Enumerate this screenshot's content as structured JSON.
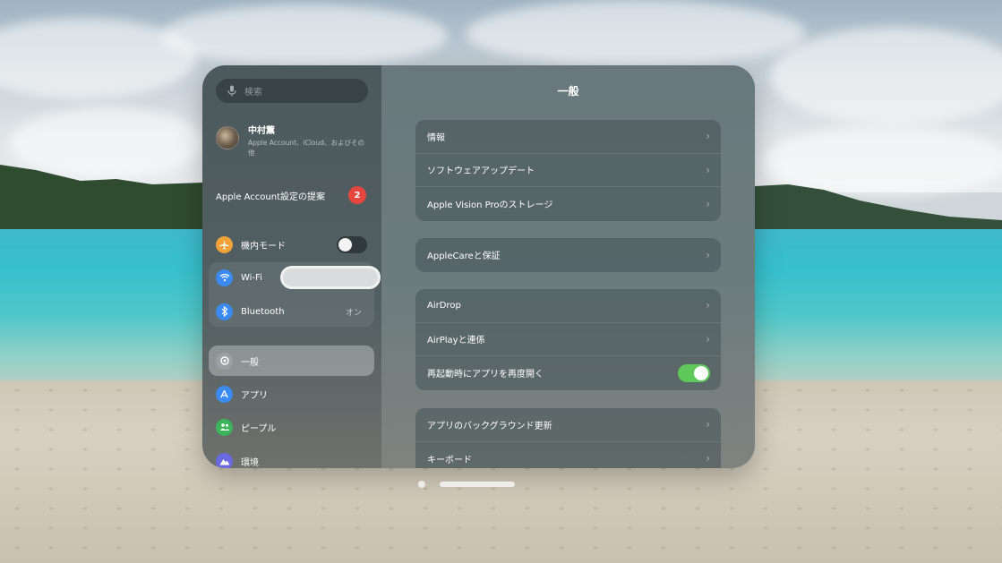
{
  "search": {
    "placeholder": "検索"
  },
  "profile": {
    "name": "中村薫",
    "subtitle": "Apple Account、iCloud、およびその他"
  },
  "suggestion": {
    "label": "Apple Account設定の提案",
    "badge": "2"
  },
  "sidebar": {
    "items": [
      {
        "label": "機内モード",
        "icon": "airplane-icon",
        "color": "#f0a23a",
        "toggle": false
      },
      {
        "label": "Wi-Fi",
        "icon": "wifi-icon",
        "color": "#3b8af0"
      },
      {
        "label": "Bluetooth",
        "icon": "bluetooth-icon",
        "color": "#3b8af0",
        "value": "オン"
      },
      {
        "label": "一般",
        "icon": "gear-icon",
        "color": "#9aa0a3"
      },
      {
        "label": "アプリ",
        "icon": "app-store-icon",
        "color": "#3b8af0"
      },
      {
        "label": "ピープル",
        "icon": "people-icon",
        "color": "#3cb55a"
      },
      {
        "label": "環境",
        "icon": "mountain-icon",
        "color": "#6a6ae0"
      }
    ]
  },
  "main": {
    "title": "一般",
    "groups": [
      [
        "情報",
        "ソフトウェアアップデート",
        "Apple Vision Proのストレージ"
      ],
      [
        "AppleCareと保証"
      ],
      [
        "AirDrop",
        "AirPlayと連係",
        "再起動時にアプリを再度開く"
      ],
      [
        "アプリのバックグラウンド更新",
        "キーボード"
      ]
    ],
    "reopen_apps_toggle": true
  },
  "colors": {
    "accent_green": "#5fc85a",
    "badge_red": "#e5473f"
  }
}
